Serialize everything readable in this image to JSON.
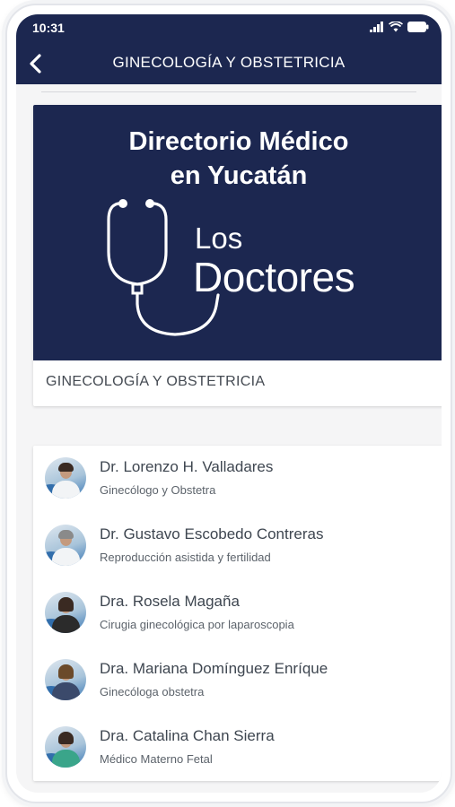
{
  "status_bar": {
    "time": "10:31"
  },
  "header": {
    "title": "GINECOLOGÍA Y OBSTETRICIA"
  },
  "banner": {
    "title_line1": "Directorio Médico",
    "title_line2": "en Yucatán",
    "logo_los": "Los",
    "logo_doctores": "Doctores",
    "caption": "GINECOLOGÍA Y OBSTETRICIA"
  },
  "doctors": [
    {
      "name": "Dr. Lorenzo H. Valladares",
      "specialty": "Ginecólogo y Obstetra"
    },
    {
      "name": "Dr. Gustavo Escobedo Contreras",
      "specialty": "Reproducción asistida y fertilidad"
    },
    {
      "name": "Dra. Rosela Magaña",
      "specialty": "Cirugia ginecológica por laparoscopia"
    },
    {
      "name": "Dra. Mariana Domínguez Enríque",
      "specialty": "Ginecóloga obstetra"
    },
    {
      "name": "Dra. Catalina Chan Sierra",
      "specialty": "Médico Materno Fetal"
    }
  ],
  "colors": {
    "brand_navy": "#1c2750",
    "background": "#f5f5f6"
  }
}
